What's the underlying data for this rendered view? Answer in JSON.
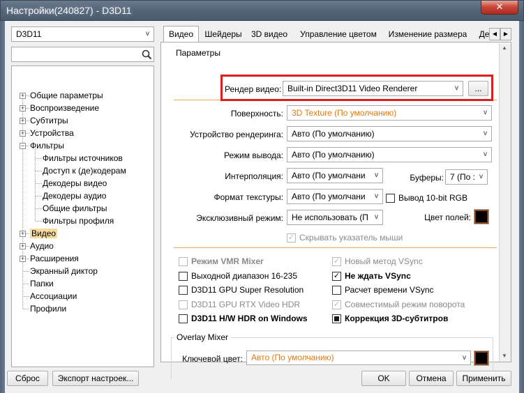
{
  "window": {
    "title": "Настройки(240827) - D3D11",
    "close_icon": "close-icon",
    "close_glyph": "✕"
  },
  "renderer_select": {
    "value": "D3D11",
    "arrow": "v"
  },
  "search": {
    "placeholder": "",
    "icon": "search-icon"
  },
  "tree": {
    "items": [
      {
        "label": "Общие параметры"
      },
      {
        "label": "Воспроизведение"
      },
      {
        "label": "Субтитры"
      },
      {
        "label": "Устройства"
      },
      {
        "label": "Фильтры"
      },
      {
        "label": "Фильтры источников"
      },
      {
        "label": "Доступ к (де)кодерам"
      },
      {
        "label": "Декодеры видео"
      },
      {
        "label": "Декодеры аудио"
      },
      {
        "label": "Общие фильтры"
      },
      {
        "label": "Фильтры профиля"
      },
      {
        "label": "Видео"
      },
      {
        "label": "Аудио"
      },
      {
        "label": "Расширения"
      },
      {
        "label": "Экранный диктор"
      },
      {
        "label": "Папки"
      },
      {
        "label": "Ассоциации"
      },
      {
        "label": "Профили"
      }
    ],
    "plus": "+",
    "minus": "−"
  },
  "tabs": [
    {
      "label": "Видео"
    },
    {
      "label": "Шейдеры"
    },
    {
      "label": "3D видео"
    },
    {
      "label": "Управление цветом"
    },
    {
      "label": "Изменение размера"
    },
    {
      "label": "Де"
    }
  ],
  "tab_scroll": {
    "left": "◀",
    "right": "▶"
  },
  "params": {
    "group_title": "Параметры",
    "render_video_label": "Рендер видео:",
    "render_video_value": "Built-in Direct3D11 Video Renderer",
    "dots_button": "...",
    "rows": [
      {
        "label": "Поверхность:",
        "value": "3D Texture (По умолчанию)"
      },
      {
        "label": "Устройство рендеринга:",
        "value": "Авто (По умолчанию)"
      },
      {
        "label": "Режим вывода:",
        "value": "Авто (По умолчанию)"
      },
      {
        "label": "Интерполяция:",
        "value": "Авто (По умолчани"
      },
      {
        "label": "Формат текстуры:",
        "value": "Авто (По умолчани"
      },
      {
        "label": "Эксклюзивный режим:",
        "value": "Не использовать (П"
      }
    ],
    "buffers_label": "Буферы:",
    "buffers_value": "7 (По :",
    "output_10bit": "Вывод 10-bit RGB",
    "field_color_label": "Цвет полей:",
    "hide_cursor": "Скрывать указатель мыши",
    "arrow": "v",
    "check": "✓"
  },
  "options": {
    "left": [
      {
        "label": "Режим VMR Mixer"
      },
      {
        "label": "Выходной диапазон 16-235"
      },
      {
        "label": "D3D11 GPU Super Resolution"
      },
      {
        "label": "D3D11 GPU RTX Video HDR"
      },
      {
        "label": "D3D11 H/W HDR on Windows"
      }
    ],
    "right": [
      {
        "label": "Новый метод VSync"
      },
      {
        "label": "Не ждать VSync"
      },
      {
        "label": "Расчет времени VSync"
      },
      {
        "label": "Совместимый режим поворота"
      },
      {
        "label": "Коррекция 3D-субтитров"
      }
    ]
  },
  "overlay": {
    "group_title": "Overlay Mixer",
    "key_color_label": "Ключевой цвет:",
    "key_color_value": "Авто (По умолчанию)"
  },
  "scrollbar": {
    "up": "▲",
    "down": "▼"
  },
  "buttons": {
    "reset": "Сброс",
    "export": "Экспорт настроек...",
    "ok": "OK",
    "cancel": "Отмена",
    "apply": "Применить"
  },
  "colors": {
    "accent_orange": "#e07a10",
    "highlight_red": "#d8201e",
    "selection": "#fadb9a"
  }
}
